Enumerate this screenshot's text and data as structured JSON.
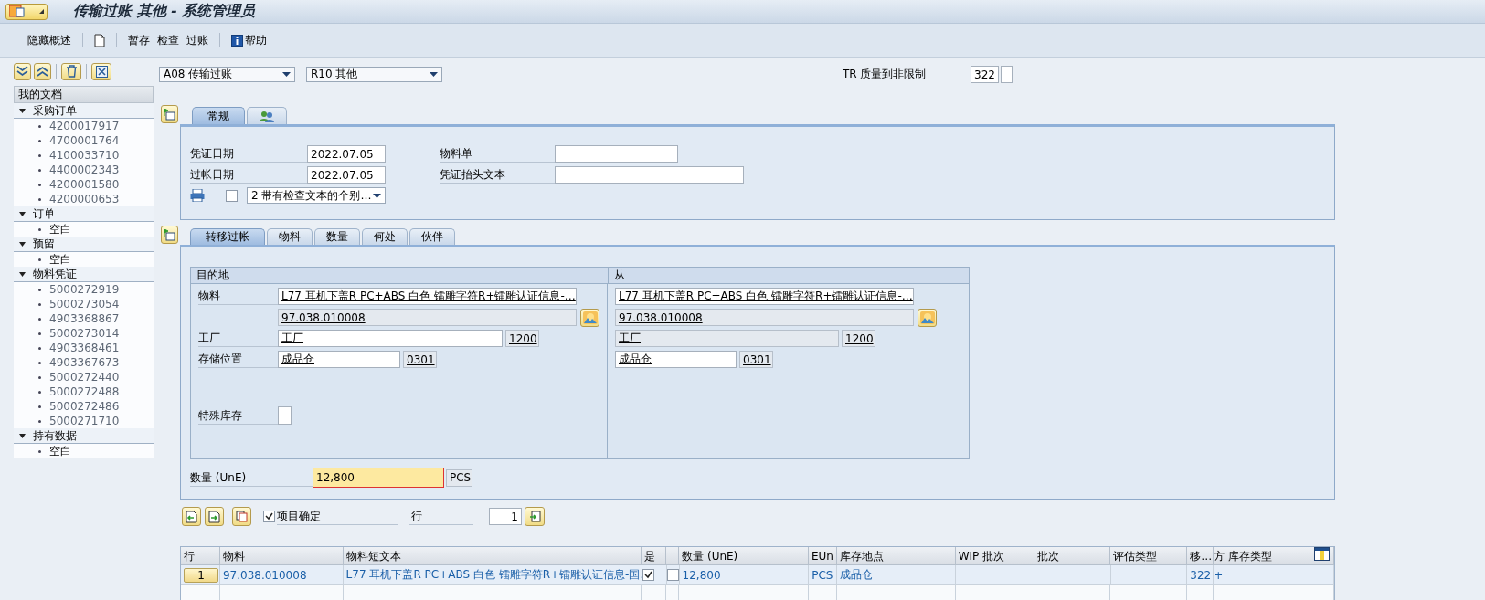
{
  "window": {
    "title": "传输过账 其他 - 系统管理员"
  },
  "toolbar": [
    {
      "kind": "text",
      "label": "隐藏概述"
    },
    {
      "kind": "new-document"
    },
    {
      "kind": "text",
      "label": "暂存"
    },
    {
      "kind": "text",
      "label": "检查"
    },
    {
      "kind": "text",
      "label": "过账"
    },
    {
      "kind": "help",
      "label": "帮助"
    }
  ],
  "sidebar": {
    "title": "我的文档",
    "groups": [
      {
        "label": "采购订单",
        "expanded": true,
        "children": [
          {
            "kind": "link",
            "label": "4200017917"
          },
          {
            "kind": "link",
            "label": "4700001764"
          },
          {
            "kind": "link",
            "label": "4100033710"
          },
          {
            "kind": "link",
            "label": "4400002343"
          },
          {
            "kind": "link",
            "label": "4200001580"
          },
          {
            "kind": "link",
            "label": "4200000653"
          }
        ]
      },
      {
        "label": "订单",
        "expanded": true,
        "children": [
          {
            "kind": "empty",
            "label": "空白"
          }
        ]
      },
      {
        "label": "预留",
        "expanded": true,
        "children": [
          {
            "kind": "empty",
            "label": "空白"
          }
        ]
      },
      {
        "label": "物料凭证",
        "expanded": true,
        "children": [
          {
            "kind": "link",
            "label": "5000272919"
          },
          {
            "kind": "link",
            "label": "5000273054"
          },
          {
            "kind": "link",
            "label": "4903368867"
          },
          {
            "kind": "link",
            "label": "5000273014"
          },
          {
            "kind": "link",
            "label": "4903368461"
          },
          {
            "kind": "link",
            "label": "4903367673"
          },
          {
            "kind": "link",
            "label": "5000272440"
          },
          {
            "kind": "link",
            "label": "5000272488"
          },
          {
            "kind": "link",
            "label": "5000272486"
          },
          {
            "kind": "link",
            "label": "5000271710"
          }
        ]
      },
      {
        "label": "持有数据",
        "expanded": true,
        "children": [
          {
            "kind": "empty",
            "label": "空白"
          }
        ]
      }
    ]
  },
  "transaction": {
    "action": "A08 传输过账",
    "reference": "R10 其他",
    "movement_text": "TR 质量到非限制",
    "movement_type": "322"
  },
  "header_tabs": [
    {
      "kind": "text",
      "label": "常规",
      "selected": true
    },
    {
      "kind": "partners-icon",
      "selected": false
    }
  ],
  "header": {
    "document_date": {
      "label": "凭证日期",
      "value": "2022.07.05"
    },
    "posting_date": {
      "label": "过帐日期",
      "value": "2022.07.05"
    },
    "material_slip": {
      "label": "物料单"
    },
    "header_text": {
      "label": "凭证抬头文本"
    },
    "print_checked": false,
    "print_version": "2 带有检查文本的个别…"
  },
  "item_tabs": [
    {
      "label": "转移过帐",
      "selected": true
    },
    {
      "label": "物料",
      "selected": false
    },
    {
      "label": "数量",
      "selected": false
    },
    {
      "label": "何处",
      "selected": false
    },
    {
      "label": "伙伴",
      "selected": false
    }
  ],
  "destination": {
    "title": "目的地",
    "material_label": "物料",
    "material_text": "L77 耳机下盖R  PC+ABS 白色  镭雕字符R+镭雕认证信息-…",
    "material_number": "97.038.010008",
    "plant_label": "工厂",
    "plant_name": "工厂",
    "plant_code": "1200",
    "storage_label": "存储位置",
    "storage_name": "成品仓",
    "storage_code": "0301",
    "special_stock_label": "特殊库存"
  },
  "source": {
    "title": "从",
    "material_text": "L77 耳机下盖R  PC+ABS 白色  镭雕字符R+镭雕认证信息-…",
    "material_number": "97.038.010008",
    "plant_name": "工厂",
    "plant_code": "1200",
    "storage_name": "成品仓",
    "storage_code": "0301"
  },
  "quantity": {
    "label": "数量 (UnE)",
    "value": "12,800",
    "unit": "PCS"
  },
  "item_bar": {
    "confirm_label": "项目确定",
    "confirm_checked": true,
    "row_label": "行",
    "row_value": "1"
  },
  "table": {
    "columns": [
      {
        "kind": "text",
        "label": "行"
      },
      {
        "kind": "text",
        "label": "物料"
      },
      {
        "kind": "text",
        "label": "物料短文本"
      },
      {
        "kind": "text",
        "label": "是"
      },
      {
        "kind": "blank"
      },
      {
        "kind": "text",
        "label": "数量 (UnE)"
      },
      {
        "kind": "text",
        "label": "EUn"
      },
      {
        "kind": "text",
        "label": "库存地点"
      },
      {
        "kind": "text",
        "label": "WIP 批次"
      },
      {
        "kind": "text",
        "label": "批次"
      },
      {
        "kind": "text",
        "label": "评估类型"
      },
      {
        "kind": "text",
        "label": "移…"
      },
      {
        "kind": "text",
        "label": "方"
      },
      {
        "kind": "text",
        "label": "库存类型"
      }
    ],
    "rows": [
      {
        "cells": [
          {
            "kind": "button",
            "text": "1"
          },
          {
            "kind": "text",
            "text": "97.038.010008"
          },
          {
            "kind": "text",
            "text": "L77 耳机下盖R  PC+ABS 白色  镭雕字符R+镭雕认证信息-国.."
          },
          {
            "kind": "check",
            "checked": true
          },
          {
            "kind": "check",
            "checked": false
          },
          {
            "kind": "text",
            "text": "12,800"
          },
          {
            "kind": "text",
            "text": "PCS"
          },
          {
            "kind": "text",
            "text": "成品仓"
          },
          {
            "kind": "empty"
          },
          {
            "kind": "empty"
          },
          {
            "kind": "empty"
          },
          {
            "kind": "text",
            "text": "322"
          },
          {
            "kind": "text",
            "text": "+"
          },
          {
            "kind": "empty"
          }
        ]
      }
    ]
  }
}
